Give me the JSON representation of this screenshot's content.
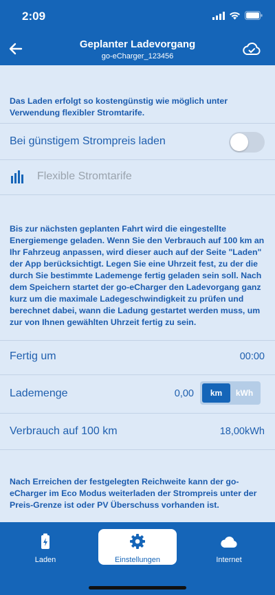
{
  "status_bar": {
    "time": "2:09"
  },
  "header": {
    "title": "Geplanter Ladevorgang",
    "subtitle": "go-eCharger_123456"
  },
  "intro_text": "Das Laden erfolgt so kostengünstig wie möglich unter Verwendung flexibler Stromtarife.",
  "cheap_toggle": {
    "label": "Bei günstigem Strompreis laden",
    "on": false
  },
  "flexible_tariffs": {
    "label": "Flexible Stromtarife"
  },
  "description": "Bis zur nächsten geplanten Fahrt wird die eingestellte Energiemenge geladen. Wenn Sie den Verbrauch auf 100 km an Ihr Fahrzeug anpassen, wird dieser auch auf der Seite \"Laden\" der App berücksichtigt. Legen Sie eine Uhrzeit fest, zu der die durch Sie bestimmte Lademenge fertig geladen sein soll. Nach dem Speichern startet der go-eCharger den Ladevorgang  ganz kurz um die maximale Ladegeschwindigkeit zu prüfen und berechnet dabei, wann die Ladung gestartet werden muss, um zur von Ihnen gewählten Uhrzeit fertig zu sein.",
  "rows": {
    "finish": {
      "label": "Fertig um",
      "value": "00:00"
    },
    "amount": {
      "label": "Lademenge",
      "value": "0,00",
      "unit_km": "km",
      "unit_kwh": "kWh",
      "selected_unit": "km"
    },
    "consumption": {
      "label": "Verbrauch auf 100 km",
      "value": "18,00",
      "unit": "kWh"
    }
  },
  "eco_text": "Nach Erreichen der festgelegten Reichweite kann der go-eCharger im Eco Modus weiterladen der Strompreis unter der Preis-Grenze ist oder PV Überschuss vorhanden ist.",
  "tabbar": {
    "tabs": [
      {
        "label": "Laden",
        "icon": "battery-charging-icon"
      },
      {
        "label": "Einstellungen",
        "icon": "gear-icon",
        "active": true
      },
      {
        "label": "Internet",
        "icon": "cloud-icon"
      }
    ]
  },
  "colors": {
    "primary": "#1565b8",
    "background": "#dde9f7",
    "text": "#1f5fae"
  }
}
